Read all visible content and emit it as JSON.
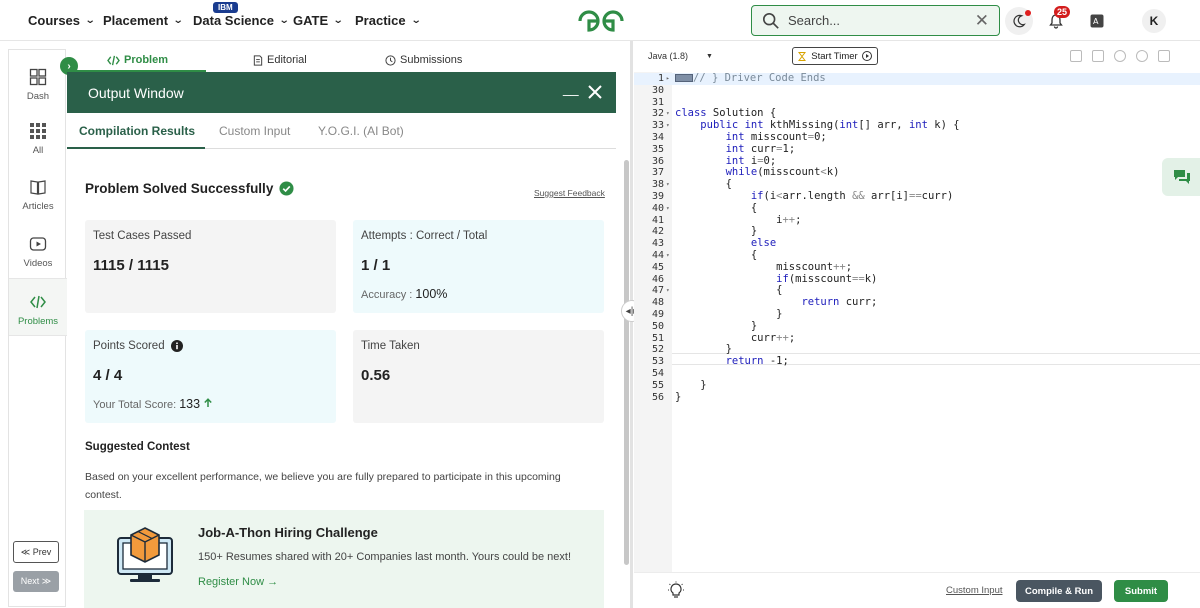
{
  "nav": {
    "items": [
      {
        "label": "Courses"
      },
      {
        "label": "Placement"
      },
      {
        "label": "Data Science",
        "badge": "IBM"
      },
      {
        "label": "GATE"
      },
      {
        "label": "Practice"
      }
    ],
    "search_placeholder": "Search...",
    "notification_count": "25",
    "avatar_initial": "K",
    "brand_color": "#2f8d46"
  },
  "sidebar": {
    "items": [
      {
        "label": "Dash",
        "icon": "dashboard-icon"
      },
      {
        "label": "All",
        "icon": "grid-icon"
      },
      {
        "label": "Articles",
        "icon": "book-icon"
      },
      {
        "label": "Videos",
        "icon": "play-icon"
      },
      {
        "label": "Problems",
        "icon": "code-icon",
        "active": true
      }
    ],
    "prev_label": "≪ Prev",
    "next_label": "Next ≫"
  },
  "problem_tabs": [
    {
      "label": "Problem",
      "icon": "code-icon",
      "active": true
    },
    {
      "label": "Editorial",
      "icon": "document-icon"
    },
    {
      "label": "Submissions",
      "icon": "clock-icon"
    }
  ],
  "output": {
    "title": "Output Window",
    "tabs": [
      {
        "label": "Compilation Results",
        "active": true
      },
      {
        "label": "Custom Input"
      },
      {
        "label": "Y.O.G.I. (AI Bot)"
      }
    ],
    "status_title": "Problem Solved Successfully",
    "suggest_feedback": "Suggest Feedback",
    "cards": {
      "test_cases": {
        "label": "Test Cases Passed",
        "value": "1115 / 1115"
      },
      "attempts": {
        "label": "Attempts : Correct / Total",
        "value": "1 / 1",
        "sub_label": "Accuracy :",
        "sub_value": "100%"
      },
      "points": {
        "label": "Points Scored",
        "value": "4 / 4",
        "sub_label": "Your Total Score:",
        "sub_value": "133"
      },
      "time": {
        "label": "Time Taken",
        "value": "0.56"
      }
    },
    "contest": {
      "heading": "Suggested Contest",
      "description": "Based on your excellent performance, we believe you are fully prepared to participate in this upcoming contest.",
      "title": "Job-A-Thon Hiring Challenge",
      "subtitle": "150+ Resumes shared with 20+ Companies last month. Yours could be next!",
      "link": "Register Now →"
    }
  },
  "editor": {
    "language": "Java (1.8)",
    "timer_label": "Start Timer",
    "custom_input_label": "Custom Input",
    "compile_label": "Compile & Run",
    "submit_label": "Submit",
    "lines": [
      {
        "n": "1",
        "fold": "▸",
        "t": "// } Driver Code Ends",
        "chip": true,
        "cls": "cm",
        "hl": true
      },
      {
        "n": "30",
        "t": ""
      },
      {
        "n": "31",
        "t": ""
      },
      {
        "n": "32",
        "fold": "▾",
        "t": "class Solution {"
      },
      {
        "n": "33",
        "fold": "▾",
        "t": "    public int kthMissing(int[] arr, int k) {"
      },
      {
        "n": "34",
        "t": "        int misscount=0;"
      },
      {
        "n": "35",
        "t": "        int curr=1;"
      },
      {
        "n": "36",
        "t": "        int i=0;"
      },
      {
        "n": "37",
        "t": "        while(misscount<k)"
      },
      {
        "n": "38",
        "fold": "▾",
        "t": "        {"
      },
      {
        "n": "39",
        "t": "            if(i<arr.length && arr[i]==curr)"
      },
      {
        "n": "40",
        "fold": "▾",
        "t": "            {"
      },
      {
        "n": "41",
        "t": "                i++;"
      },
      {
        "n": "42",
        "t": "            }"
      },
      {
        "n": "43",
        "t": "            else"
      },
      {
        "n": "44",
        "fold": "▾",
        "t": "            {"
      },
      {
        "n": "45",
        "t": "                misscount++;"
      },
      {
        "n": "46",
        "t": "                if(misscount==k)"
      },
      {
        "n": "47",
        "fold": "▾",
        "t": "                {"
      },
      {
        "n": "48",
        "t": "                    return curr;"
      },
      {
        "n": "49",
        "t": "                }"
      },
      {
        "n": "50",
        "t": "            }"
      },
      {
        "n": "51",
        "t": "            curr++;"
      },
      {
        "n": "52",
        "t": "        }"
      },
      {
        "n": "53",
        "t": "        return -1;"
      },
      {
        "n": "54",
        "t": ""
      },
      {
        "n": "55",
        "t": "    }"
      },
      {
        "n": "56",
        "t": "}"
      }
    ]
  }
}
